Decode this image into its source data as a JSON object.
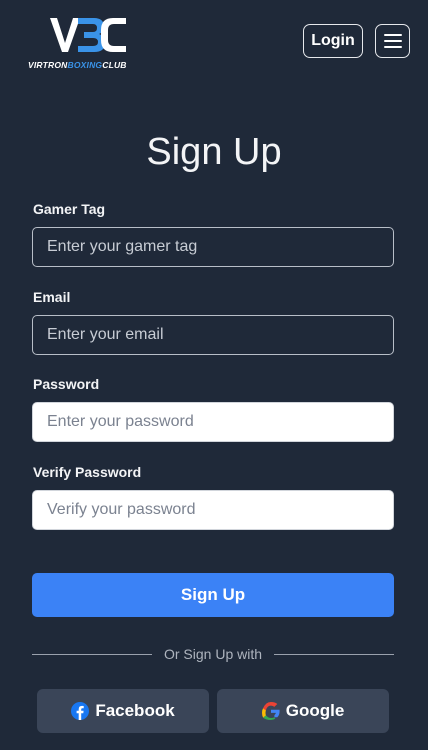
{
  "header": {
    "logo_text_white_1": "VIRTRON",
    "logo_text_blue": "BOXING",
    "logo_text_white_2": "CLUB",
    "login_label": "Login",
    "menu_icon": "hamburger-icon"
  },
  "page": {
    "title": "Sign Up"
  },
  "form": {
    "gamer_tag": {
      "label": "Gamer Tag",
      "placeholder": "Enter your gamer tag",
      "value": ""
    },
    "email": {
      "label": "Email",
      "placeholder": "Enter your email",
      "value": ""
    },
    "password": {
      "label": "Password",
      "placeholder": "Enter your password",
      "value": ""
    },
    "verify_password": {
      "label": "Verify Password",
      "placeholder": "Verify your password",
      "value": ""
    },
    "submit_label": "Sign Up"
  },
  "social": {
    "divider_text": "Or Sign Up with",
    "facebook_label": "Facebook",
    "facebook_icon": "facebook-icon",
    "google_label": "Google",
    "google_icon": "google-icon"
  },
  "colors": {
    "background": "#1f2939",
    "primary": "#3b82f6",
    "logo_blue": "#3a93e8",
    "social_button": "#3a4558"
  }
}
